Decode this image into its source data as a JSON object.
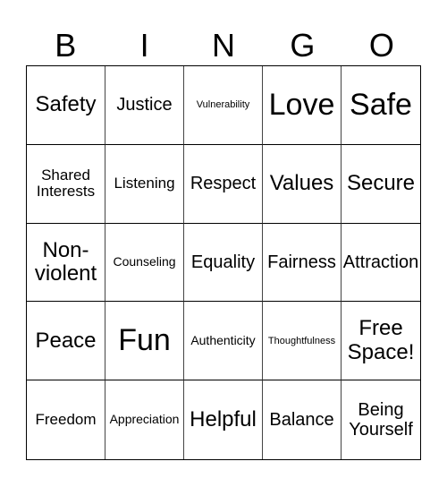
{
  "header": [
    "B",
    "I",
    "N",
    "G",
    "O"
  ],
  "cells": [
    {
      "text": "Safety",
      "size": "xl"
    },
    {
      "text": "Justice",
      "size": "lg"
    },
    {
      "text": "Vulnerability",
      "size": "xs"
    },
    {
      "text": "Love",
      "size": "huge"
    },
    {
      "text": "Safe",
      "size": "huge"
    },
    {
      "text": "Shared Interests",
      "size": "md"
    },
    {
      "text": "Listening",
      "size": "md"
    },
    {
      "text": "Respect",
      "size": "lg"
    },
    {
      "text": "Values",
      "size": "xl"
    },
    {
      "text": "Secure",
      "size": "xl"
    },
    {
      "text": "Non-violent",
      "size": "xl"
    },
    {
      "text": "Counseling",
      "size": "sm"
    },
    {
      "text": "Equality",
      "size": "lg"
    },
    {
      "text": "Fairness",
      "size": "lg"
    },
    {
      "text": "Attraction",
      "size": "lg"
    },
    {
      "text": "Peace",
      "size": "xl"
    },
    {
      "text": "Fun",
      "size": "huge"
    },
    {
      "text": "Authenticity",
      "size": "sm"
    },
    {
      "text": "Thoughtfulness",
      "size": "xs"
    },
    {
      "text": "Free Space!",
      "size": "xl"
    },
    {
      "text": "Freedom",
      "size": "md"
    },
    {
      "text": "Appreciation",
      "size": "sm"
    },
    {
      "text": "Helpful",
      "size": "xl"
    },
    {
      "text": "Balance",
      "size": "lg"
    },
    {
      "text": "Being Yourself",
      "size": "lg"
    }
  ]
}
